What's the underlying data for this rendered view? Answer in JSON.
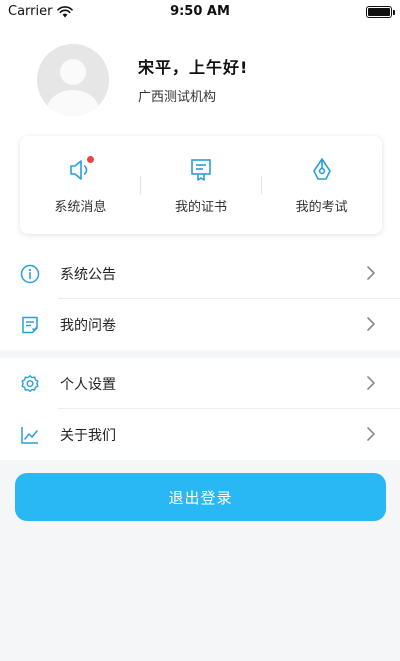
{
  "status_bar": {
    "carrier": "Carrier",
    "time": "9:50 AM"
  },
  "profile": {
    "greeting": "宋平，上午好!",
    "organization": "广西测试机构"
  },
  "quick_actions": [
    {
      "label": "系统消息",
      "icon": "speaker-icon",
      "has_badge": true
    },
    {
      "label": "我的证书",
      "icon": "certificate-icon",
      "has_badge": false
    },
    {
      "label": "我的考试",
      "icon": "pen-icon",
      "has_badge": false
    }
  ],
  "menu": {
    "group1": [
      {
        "label": "系统公告",
        "icon": "info-icon"
      },
      {
        "label": "我的问卷",
        "icon": "questionnaire-icon"
      }
    ],
    "group2": [
      {
        "label": "个人设置",
        "icon": "gear-icon"
      },
      {
        "label": "关于我们",
        "icon": "line-chart-icon"
      }
    ]
  },
  "logout": {
    "label": "退出登录"
  },
  "colors": {
    "accent": "#29b8f4",
    "icon": "#2a9fd6",
    "badge": "#e9473b",
    "chevron": "#8a8a8a"
  }
}
